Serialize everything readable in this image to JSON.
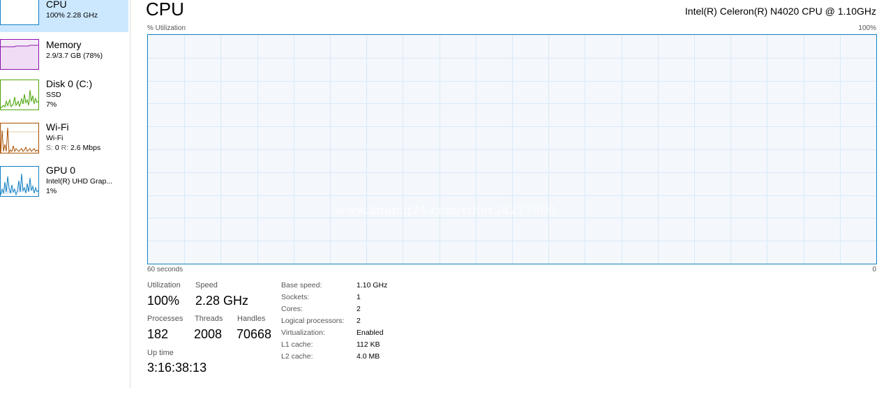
{
  "sidebar": {
    "items": [
      {
        "name": "CPU",
        "line1": "100%  2.28 GHz"
      },
      {
        "name": "Memory",
        "line1": "2.9/3.7 GB (78%)"
      },
      {
        "name": "Disk 0 (C:)",
        "line1": "SSD",
        "line2": "7%"
      },
      {
        "name": "Wi-Fi",
        "line1": "Wi-Fi",
        "line2_label": "S:",
        "line2_s": "0",
        "line2_r_label": "R:",
        "line2_r": "2.6 Mbps"
      },
      {
        "name": "GPU 0",
        "line1": "Intel(R) UHD Grap...",
        "line2": "1%"
      }
    ],
    "colors": {
      "cpu": "#1180c2",
      "memory": "#8b12ae",
      "disk": "#4da60c",
      "wifi": "#a74f01",
      "gpu": "#1180c2"
    }
  },
  "header": {
    "title": "CPU",
    "cpu_model": "Intel(R) Celeron(R) N4020 CPU @ 1.10GHz"
  },
  "graph": {
    "y_label": "% Utilization",
    "y_max_label": "100%",
    "x_left_label": "60 seconds",
    "x_right_label": "0",
    "grid_color": "#d9eaf7",
    "border_color": "#1180c2"
  },
  "stats": {
    "utilization_label": "Utilization",
    "utilization": "100%",
    "speed_label": "Speed",
    "speed": "2.28 GHz",
    "processes_label": "Processes",
    "processes": "182",
    "threads_label": "Threads",
    "threads": "2008",
    "handles_label": "Handles",
    "handles": "70668",
    "uptime_label": "Up time",
    "uptime": "3:16:38:13"
  },
  "details": [
    {
      "label": "Base speed:",
      "value": "1.10 GHz"
    },
    {
      "label": "Sockets:",
      "value": "1"
    },
    {
      "label": "Cores:",
      "value": "2"
    },
    {
      "label": "Logical processors:",
      "value": "2"
    },
    {
      "label": "Virtualization:",
      "value": "Enabled"
    },
    {
      "label": "L1 cache:",
      "value": "112 KB"
    },
    {
      "label": "L2 cache:",
      "value": "4.0 MB"
    }
  ],
  "watermark": "www.kuaiug24.com/vthor24277800"
}
